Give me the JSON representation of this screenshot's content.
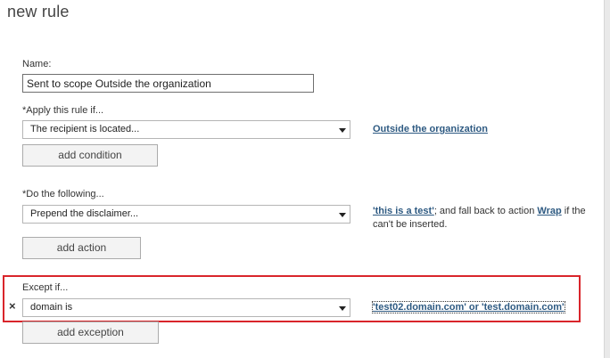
{
  "title": "new rule",
  "name": {
    "label": "Name:",
    "value": "Sent to scope Outside the organization"
  },
  "condition": {
    "label": "*Apply this rule if...",
    "selected": "The recipient is located...",
    "link": "Outside the organization",
    "add_button": "add condition"
  },
  "action": {
    "label": "*Do the following...",
    "selected": "Prepend the disclaimer...",
    "link_text": "'this is a test'",
    "text_after": "; and fall back to action ",
    "link_action": "Wrap",
    "text_end_1": " if the",
    "text_end_2": "can't be inserted.",
    "add_button": "add action"
  },
  "exception": {
    "label": "Except if...",
    "remove_icon": "×",
    "selected": "domain is",
    "link": "'test02.domain.com' or 'test.domain.com'",
    "add_button": "add exception"
  },
  "colors": {
    "highlight": "#d9252b",
    "link": "#2e5a82"
  }
}
